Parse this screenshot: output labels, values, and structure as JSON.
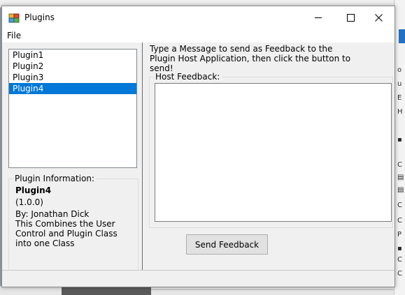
{
  "window": {
    "title": "Plugins",
    "icon": "plugins-app-icon",
    "controls": {
      "minimize": "minimize-icon",
      "maximize": "maximize-icon",
      "close": "close-icon"
    }
  },
  "menu": {
    "file": "File"
  },
  "plugins": {
    "items": [
      "Plugin1",
      "Plugin2",
      "Plugin3",
      "Plugin4"
    ],
    "selected_index": 3
  },
  "plugin_info": {
    "group_label": "Plugin Information:",
    "name": "Plugin4",
    "version": "(1.0.0)",
    "author": "By: Jonathan Dick",
    "description": "This Combines the User Control and Plugin Class into one Class"
  },
  "feedback": {
    "instructions": "Type a Message to send as Feedback to the Plugin Host Application, then click the button to send!",
    "group_label": "Host Feedback:",
    "text_value": "",
    "send_button_label": "Send Feedback"
  },
  "colors": {
    "selection": "#0078d7",
    "window_bg": "#f0f0f0",
    "titlebar_bg": "#ffffff"
  }
}
